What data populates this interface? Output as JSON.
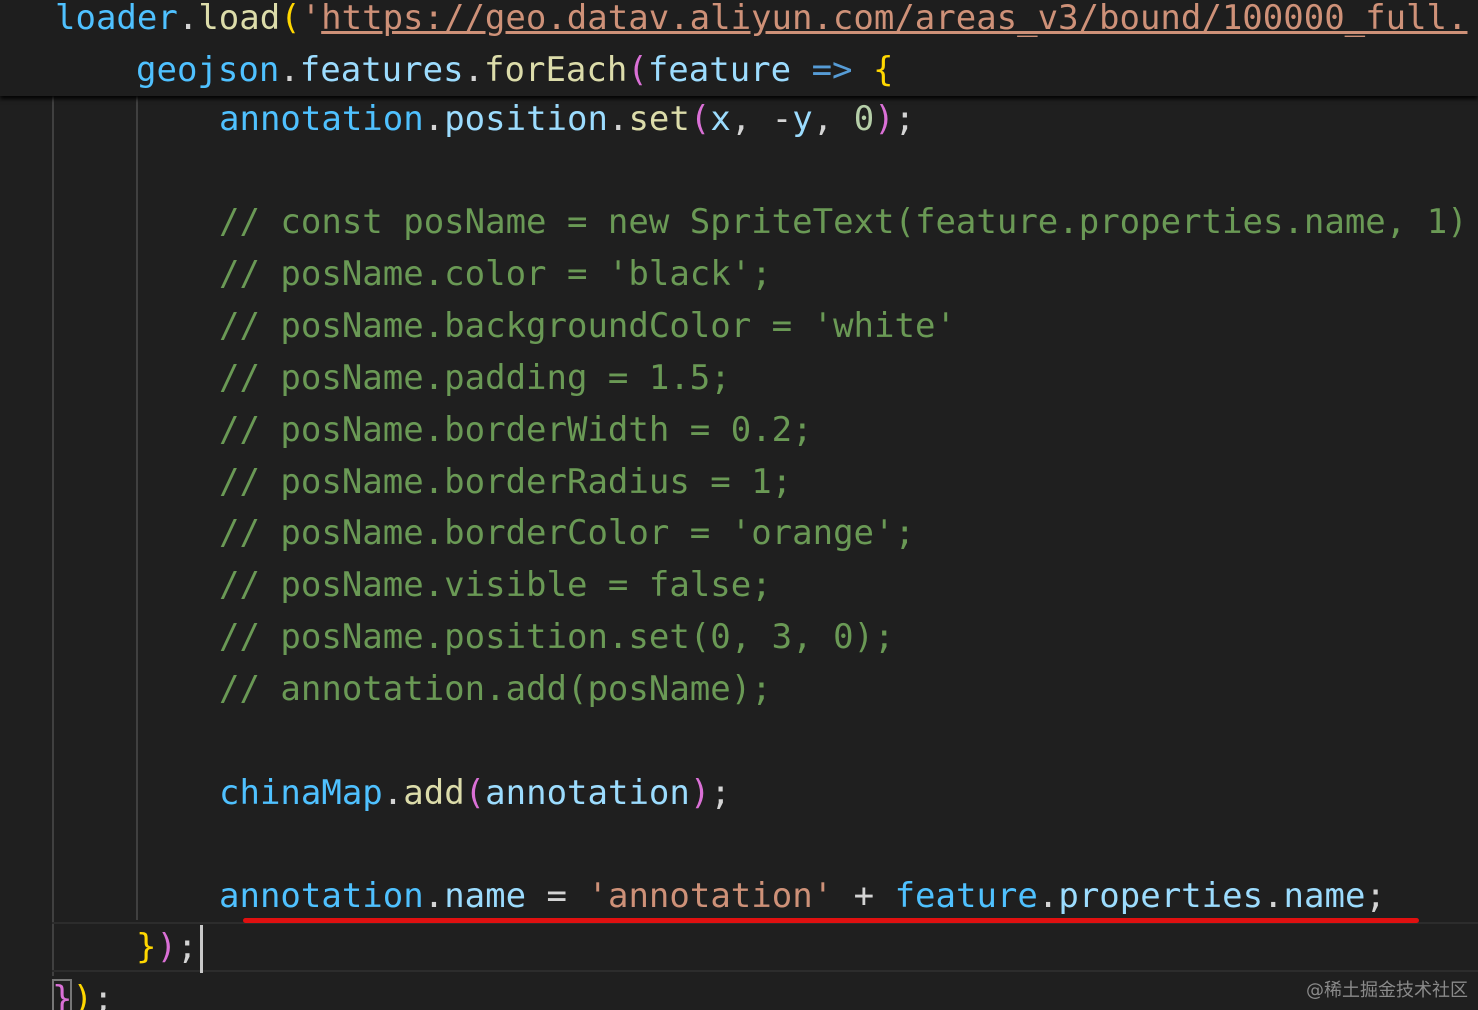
{
  "sticky_scroll": {
    "line1": {
      "obj": "loader",
      "dot": ".",
      "method": "load",
      "open_paren": "(",
      "quote": "'",
      "url": "https://geo.datav.aliyun.com/areas_v3/bound/100000_full."
    },
    "line2": {
      "obj": "geojson",
      "dot1": ".",
      "prop": "features",
      "dot2": ".",
      "method": "forEach",
      "open_paren": "(",
      "param": "feature",
      "arrow": " => ",
      "brace": "{"
    }
  },
  "code": {
    "position_line": {
      "obj": "annotation",
      "dot1": ".",
      "prop": "position",
      "dot2": ".",
      "method": "set",
      "open": "(",
      "x": "x",
      "sep1": ", -",
      "y": "y",
      "sep2": ", ",
      "zero": "0",
      "close": ")",
      "semi": ";"
    },
    "comments": [
      "// const posName = new SpriteText(feature.properties.name, 1)",
      "// posName.color = 'black';",
      "// posName.backgroundColor = 'white'",
      "// posName.padding = 1.5;",
      "// posName.borderWidth = 0.2;",
      "// posName.borderRadius = 1;",
      "// posName.borderColor = 'orange';",
      "// posName.visible = false;",
      "// posName.position.set(0, 3, 0);",
      "// annotation.add(posName);"
    ],
    "add_line": {
      "obj": "chinaMap",
      "dot": ".",
      "method": "add",
      "open": "(",
      "arg": "annotation",
      "close": ")",
      "semi": ";"
    },
    "name_line": {
      "obj": "annotation",
      "dot1": ".",
      "prop": "name",
      "eq": " = ",
      "str": "'annotation'",
      "plus": " + ",
      "obj2": "feature",
      "dot2": ".",
      "prop2": "properties",
      "dot3": ".",
      "prop3": "name",
      "semi": ";"
    },
    "close_line": {
      "brace": "}",
      "paren": ")",
      "semi": ";"
    },
    "final_line": {
      "brace": "}",
      "paren": ")",
      "semi": ";"
    }
  },
  "watermark": "@稀土掘金技术社区",
  "colors": {
    "background": "#1f1f1f",
    "comment": "#6a9955",
    "string": "#ce9178",
    "variable": "#4fc1ff",
    "property": "#9cdcfe",
    "function": "#dcdcaa",
    "bracket_gold": "#ffd700",
    "bracket_violet": "#da70d6",
    "bracket_blue": "#179fff",
    "annotation_underline": "#e01010"
  }
}
